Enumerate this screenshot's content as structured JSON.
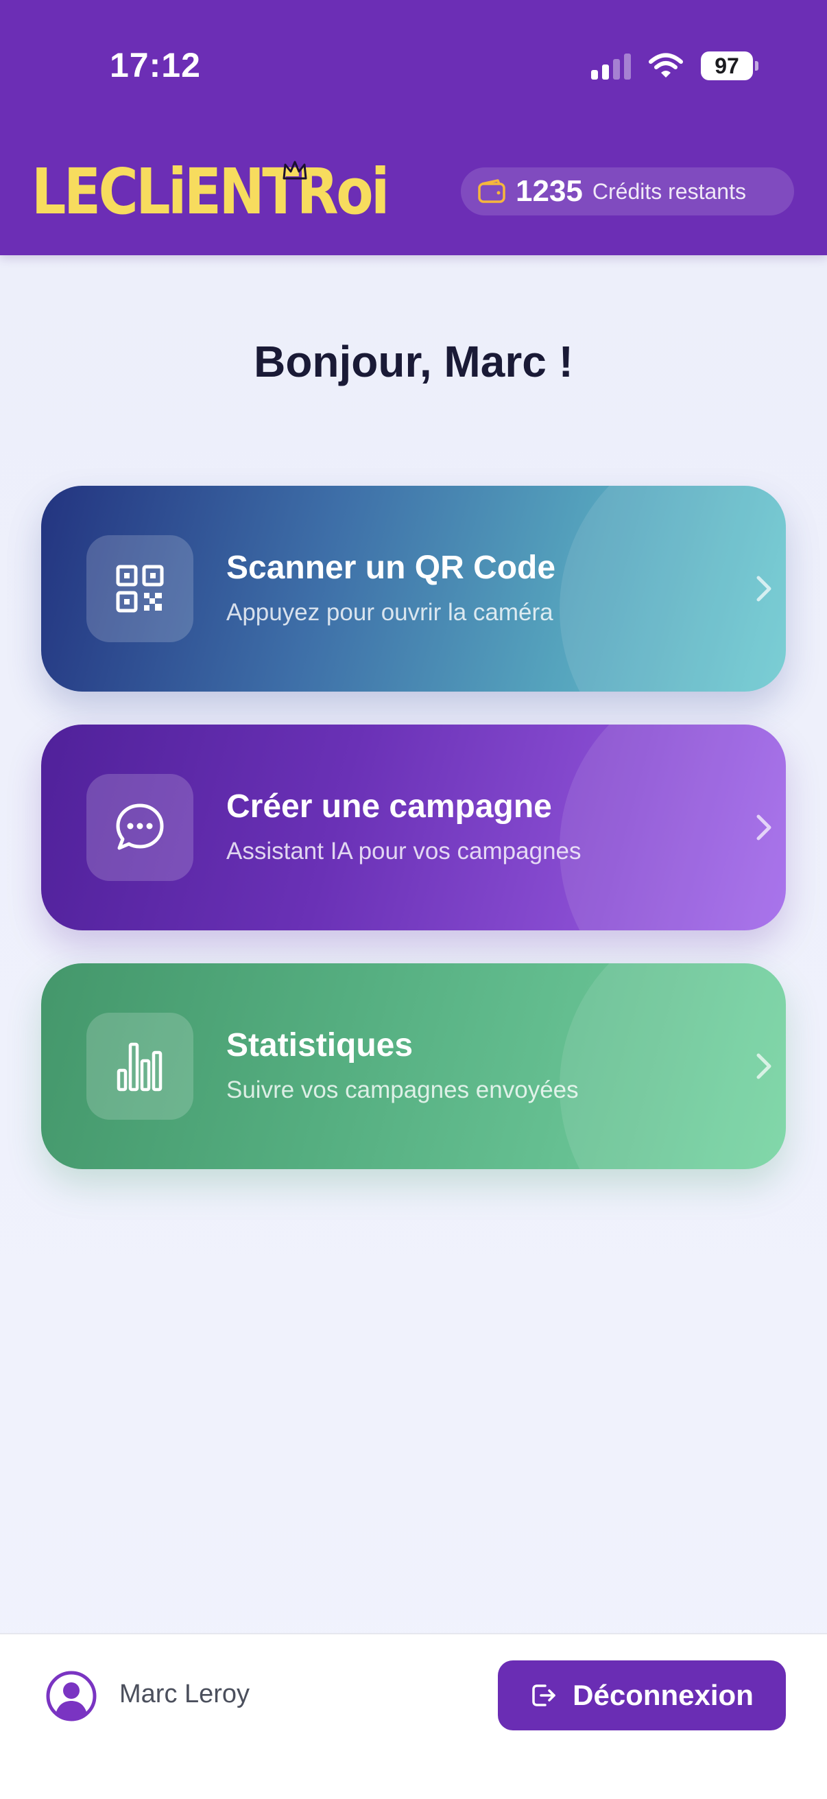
{
  "status_bar": {
    "time": "17:12",
    "battery": "97"
  },
  "header": {
    "logo": "LECLiENTRoi",
    "credits_value": "1235",
    "credits_label": "Crédits restants"
  },
  "greeting": "Bonjour, Marc !",
  "cards": [
    {
      "title": "Scanner un QR Code",
      "subtitle": "Appuyez pour ouvrir la caméra",
      "icon": "qr-code-icon"
    },
    {
      "title": "Créer une campagne",
      "subtitle": "Assistant IA pour vos campagnes",
      "icon": "chat-bubble-icon"
    },
    {
      "title": "Statistiques",
      "subtitle": "Suivre vos campagnes envoyées",
      "icon": "bar-chart-icon"
    }
  ],
  "footer": {
    "user_name": "Marc Leroy",
    "logout_label": "Déconnexion"
  },
  "colors": {
    "header": "#6c2eb5",
    "logo": "#f7dc5e",
    "logout_button": "#6a2db4",
    "card_qr": "#3e6fa8",
    "card_campaign": "#6a31b6",
    "card_stats": "#55ae80"
  }
}
